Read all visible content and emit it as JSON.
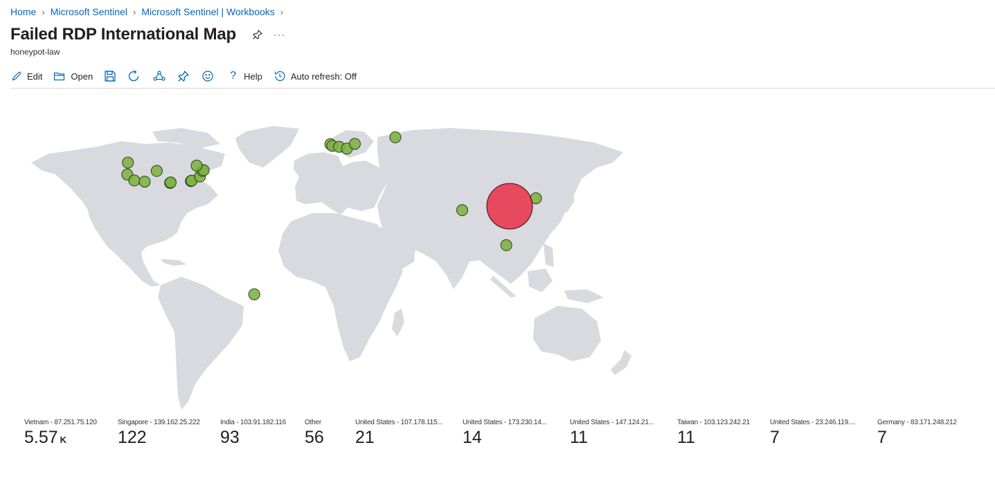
{
  "breadcrumb": [
    "Home",
    "Microsoft Sentinel",
    "Microsoft Sentinel | Workbooks"
  ],
  "page": {
    "title": "Failed RDP International Map",
    "subtitle": "honeypot-law"
  },
  "toolbar": {
    "edit": "Edit",
    "open": "Open",
    "save_icon": "save-icon",
    "refresh_icon": "refresh-icon",
    "share_icon": "share-icon",
    "pin_icon": "pin-icon",
    "feedback_icon": "smiley-icon",
    "help": "Help",
    "auto_refresh": "Auto refresh: Off"
  },
  "colors": {
    "link": "#0067b8",
    "land": "#d8dadf",
    "bubble_green": "#7cb342",
    "bubble_red": "#e8344c"
  },
  "map_points": [
    {
      "lat": 43,
      "lon": -122
    },
    {
      "lat": 37,
      "lon": -122.4
    },
    {
      "lat": 34,
      "lon": -118.2
    },
    {
      "lat": 33.4,
      "lon": -112
    },
    {
      "lat": 38.8,
      "lon": -104.8
    },
    {
      "lat": 32.8,
      "lon": -96.8
    },
    {
      "lat": 33,
      "lon": -96.5
    },
    {
      "lat": 33.7,
      "lon": -84.4
    },
    {
      "lat": 33.9,
      "lon": -84
    },
    {
      "lat": 36,
      "lon": -79
    },
    {
      "lat": 38.8,
      "lon": -77.5
    },
    {
      "lat": 39.2,
      "lon": -76.8
    },
    {
      "lat": 41.5,
      "lon": -81
    },
    {
      "lat": 52.3,
      "lon": -1.2
    },
    {
      "lat": 51.5,
      "lon": 0
    },
    {
      "lat": 51,
      "lon": 4
    },
    {
      "lat": 50.1,
      "lon": 8.7
    },
    {
      "lat": 52.5,
      "lon": 13.4
    },
    {
      "lat": 55.8,
      "lon": 37.6
    },
    {
      "lat": 19,
      "lon": 77.5
    },
    {
      "lat": 1.3,
      "lon": 103.8
    },
    {
      "lat": 25,
      "lon": 121.5
    },
    {
      "lat": -23.5,
      "lon": -46.6
    }
  ],
  "highlight_point": {
    "lat": 21,
    "lon": 105.8,
    "value": 5570
  },
  "tiles": [
    {
      "label": "Vietnam - 87.251.75.120",
      "value": "5.57",
      "unit": "K"
    },
    {
      "label": "Singapore - 139.162.25.222",
      "value": "122",
      "unit": ""
    },
    {
      "label": "India - 103.91.182.116",
      "value": "93",
      "unit": ""
    },
    {
      "label": "Other",
      "value": "56",
      "unit": ""
    },
    {
      "label": "United States - 107.178.115...",
      "value": "21",
      "unit": ""
    },
    {
      "label": "United States - 173.230.14...",
      "value": "14",
      "unit": ""
    },
    {
      "label": "United States - 147.124.21...",
      "value": "11",
      "unit": ""
    },
    {
      "label": "Taiwan - 103.123.242.21",
      "value": "11",
      "unit": ""
    },
    {
      "label": "United States - 23.246.119....",
      "value": "7",
      "unit": ""
    },
    {
      "label": "Germany - 83.171.248.212",
      "value": "7",
      "unit": ""
    }
  ]
}
